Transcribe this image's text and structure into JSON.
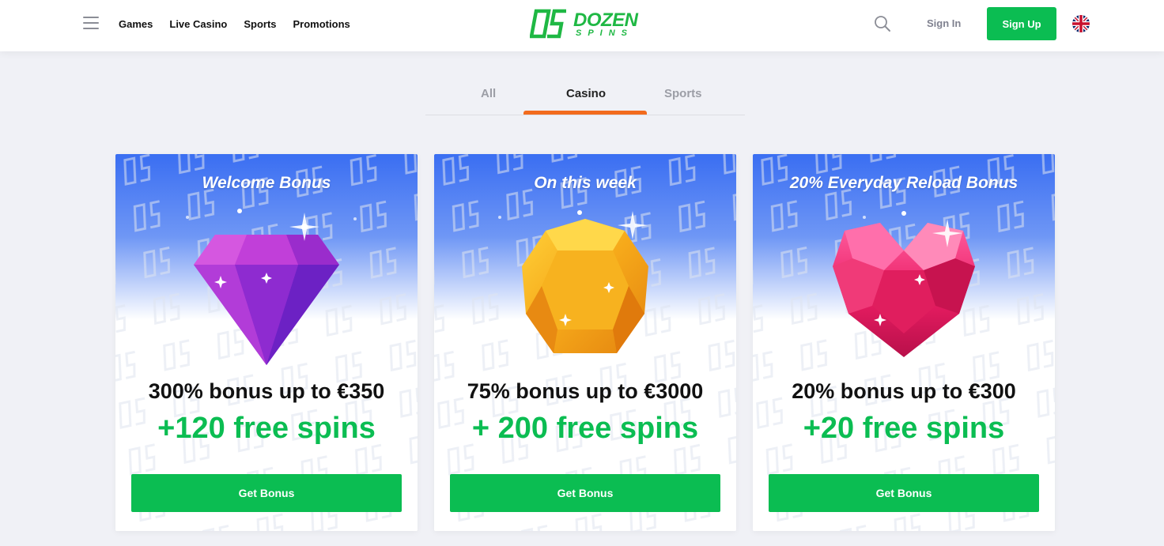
{
  "header": {
    "nav": [
      "Games",
      "Live Casino",
      "Sports",
      "Promotions"
    ],
    "logo_top": "DOZEN",
    "logo_bottom": "SPINS",
    "signin_label": "Sign In",
    "signup_label": "Sign Up"
  },
  "tabs": [
    {
      "label": "All",
      "active": false
    },
    {
      "label": "Casino",
      "active": true
    },
    {
      "label": "Sports",
      "active": false
    }
  ],
  "cards": [
    {
      "title": "Welcome Bonus",
      "line1": "300% bonus up to €350",
      "line2": "+120 free spins",
      "button": "Get Bonus",
      "art": "purple-diamond-icon"
    },
    {
      "title": "On this week",
      "line1": "75% bonus up to €3000",
      "line2": "+ 200 free spins",
      "button": "Get Bonus",
      "art": "gold-gem-icon"
    },
    {
      "title": "20% Everyday Reload Bonus",
      "line1": "20% bonus up to €300",
      "line2": "+20 free spins",
      "button": "Get Bonus",
      "art": "pink-heart-gem-icon"
    }
  ],
  "colors": {
    "accent_green": "#0bbd52",
    "tab_indicator": "#f26b1d",
    "card_sky": "#3a6ef2"
  }
}
